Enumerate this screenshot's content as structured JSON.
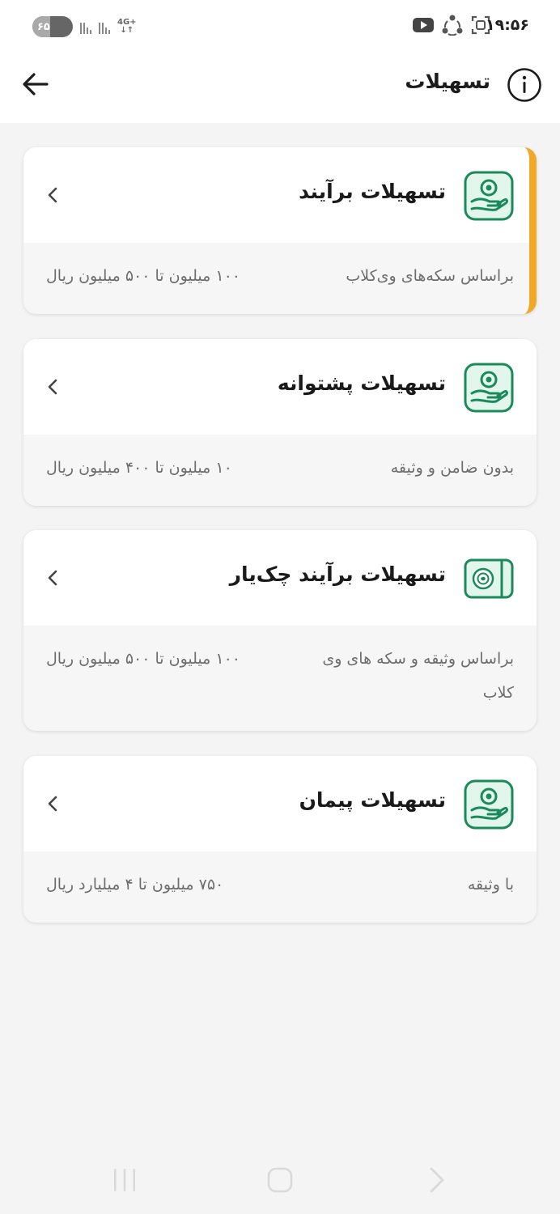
{
  "status_bar": {
    "time": "۱۹:۵۶",
    "battery": "۶۵",
    "network": "4G+",
    "icons": [
      "youtube-icon",
      "share-icon",
      "screenshot-icon"
    ]
  },
  "header": {
    "title": "تسهیلات",
    "back_icon": "arrow-left-icon",
    "info_icon": "info-icon"
  },
  "colors": {
    "accent": "#f1a826",
    "icon_green": "#1b8a5a",
    "icon_bg": "#e3f6ec"
  },
  "cards": [
    {
      "title": "تسهیلات برآیند",
      "description": "براساس سکه‌های وی‌کلاب",
      "range": "۱۰۰ میلیون تا ۵۰۰ میلیون ریال",
      "icon": "hand-coin-icon",
      "selected": true
    },
    {
      "title": "تسهیلات پشتوانه",
      "description": "بدون ضامن و وثیقه",
      "range": "۱۰ میلیون تا ۴۰۰ میلیون ریال",
      "icon": "hand-coin-icon",
      "selected": false
    },
    {
      "title": "تسهیلات برآیند چک‌یار",
      "description": "براساس وثیقه و سکه های وی کلاب",
      "range": "۱۰۰ میلیون تا ۵۰۰ میلیون ریال",
      "icon": "check-card-icon",
      "selected": false
    },
    {
      "title": "تسهیلات پیمان",
      "description": "با وثیقه",
      "range": "۷۵۰ میلیون تا ۴ میلیارد ریال",
      "icon": "hand-coin-icon",
      "selected": false
    }
  ]
}
